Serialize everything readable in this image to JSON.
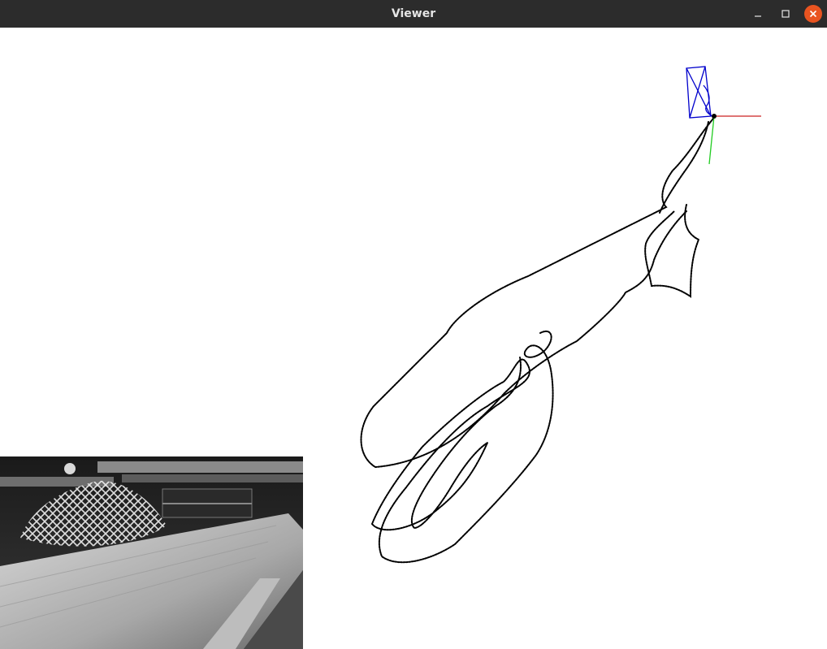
{
  "window": {
    "title": "Viewer",
    "controls": [
      "minimize",
      "maximize",
      "close"
    ]
  },
  "viewer": {
    "background": "#ffffff",
    "trajectory_color": "#000000",
    "keyframe_color": "#0000cc",
    "axis_x_color": "#cc2222",
    "axis_y_color": "#22cc22"
  },
  "camera_image": {
    "mode": "grayscale",
    "content": "warehouse-scene-with-wooden-plank-and-net"
  },
  "colors": {
    "titlebar": "#2c2c2c",
    "title_text": "#e6e6e6",
    "close_button": "#e95420"
  }
}
